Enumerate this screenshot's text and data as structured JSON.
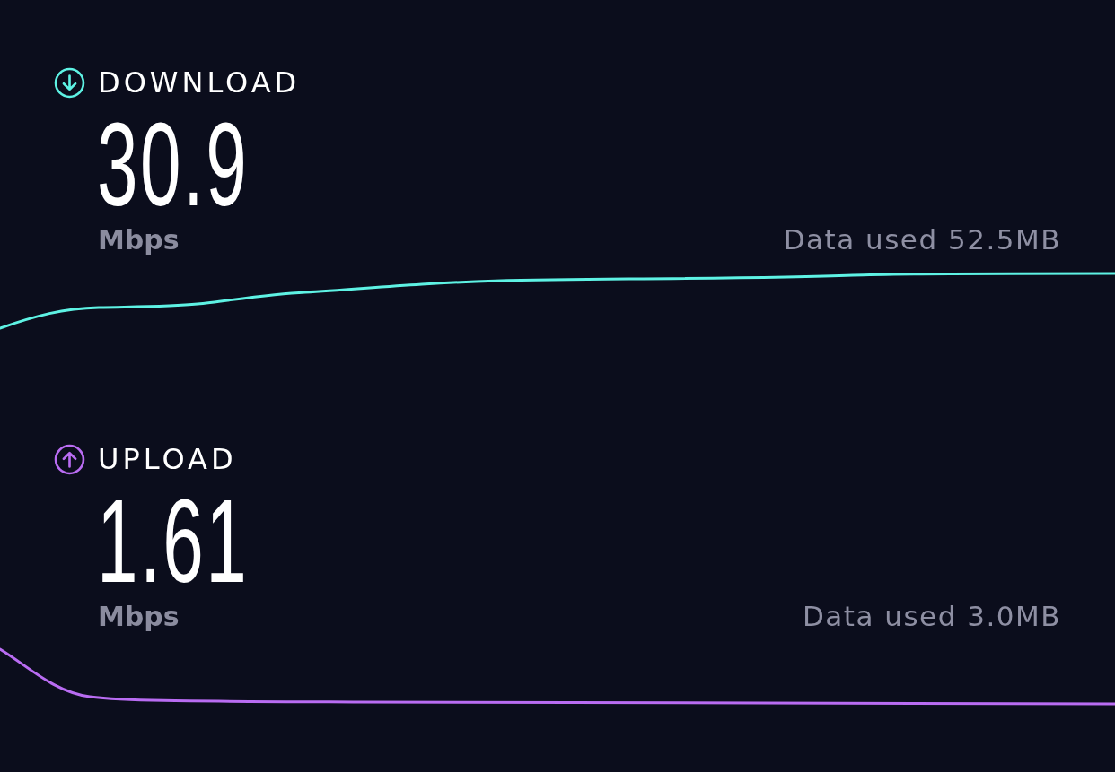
{
  "tests": [
    {
      "kind": "download",
      "label": "DOWNLOAD",
      "color": "#5ef2e4",
      "speed": "30.9",
      "unit": "Mbps",
      "data_used": "Data used 52.5MB"
    },
    {
      "kind": "upload",
      "label": "UPLOAD",
      "color": "#b96cf2",
      "speed": "1.61",
      "unit": "Mbps",
      "data_used": "Data used 3.0MB"
    }
  ]
}
